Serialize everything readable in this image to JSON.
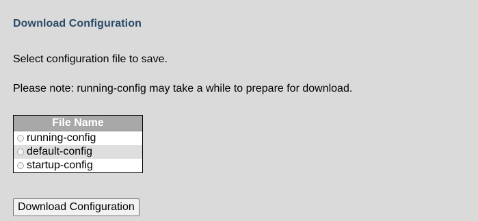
{
  "page": {
    "title": "Download Configuration",
    "instruction": "Select configuration file to save.",
    "note": "Please note: running-config may take a while to prepare for download."
  },
  "file_table": {
    "header": "File Name",
    "rows": [
      {
        "label": "running-config",
        "selected": false
      },
      {
        "label": "default-config",
        "selected": false
      },
      {
        "label": "startup-config",
        "selected": false
      }
    ]
  },
  "actions": {
    "download_label": "Download Configuration"
  },
  "colors": {
    "background": "#dadada",
    "title": "#2a4a66",
    "table_header": "#a8a8a8",
    "alt_row": "#dedede"
  }
}
